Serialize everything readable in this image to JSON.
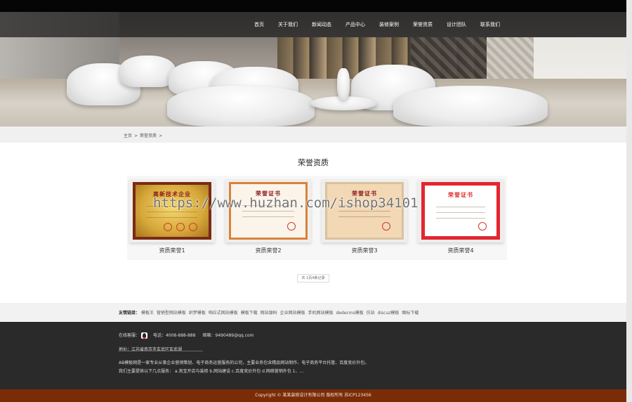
{
  "nav": {
    "items": [
      "首页",
      "关于我们",
      "新闻动态",
      "产品中心",
      "装修案例",
      "荣誉资质",
      "设计团队",
      "联系我们"
    ]
  },
  "breadcrumb": {
    "home": "主页",
    "sep": ">",
    "current": "荣誉资质",
    "tail": ">"
  },
  "page": {
    "title": "荣誉资质"
  },
  "honors": [
    {
      "caption": "资质荣誉1",
      "cert_title": "高新技术企业"
    },
    {
      "caption": "资质荣誉2",
      "cert_title": "荣誉证书"
    },
    {
      "caption": "资质荣誉3",
      "cert_title": "荣誉证书"
    },
    {
      "caption": "资质荣誉4",
      "cert_title": "荣誉证书"
    }
  ],
  "pager": {
    "text": "共 1页4条记录"
  },
  "watermark": "https://www.huzhan.com/ishop34101",
  "links": {
    "label": "友情链接：",
    "items": [
      "模板王",
      "营销型网站模板",
      "织梦模板",
      "响应式网站模板",
      "模板下载",
      "网站源码",
      "企业网站模板",
      "手机网站模板",
      "dedecms模板",
      "仿站",
      "discuz模板",
      "图标下载"
    ]
  },
  "footer": {
    "online_label": "在线客服：",
    "phone": "电话：4008-888-888",
    "email": "邮箱：9490489@qq.com",
    "address": "地址：江苏省南京市玄武区玄武湖",
    "desc1": "AB模板网是一家专业从事企业营销策划、电子商务运营服务的公司，主要业务包含精品网站制作、电子商务平台托管、百度竞价外包。",
    "desc2": "我们主要提供以下几点服务： a.淘宝开店与装修 b.网站建设 c.百度竞价外包 d.网络营销外包 1、..."
  },
  "copyright": "Copyright © 某某装修设计有限公司 版权所有   苏ICP123456",
  "colors": {
    "nav_bg": "#191919",
    "footer_bg": "#2a2a2a",
    "copyright_bg": "#7a2c06"
  }
}
